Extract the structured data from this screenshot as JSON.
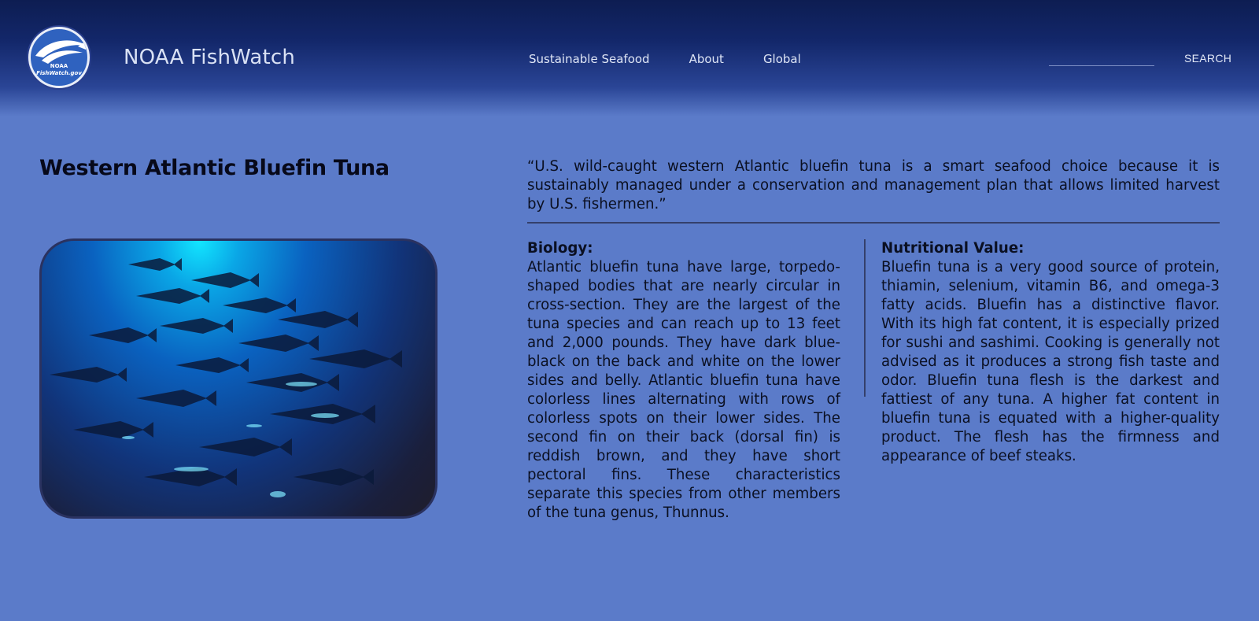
{
  "header": {
    "logo": {
      "icon": "noaa-fish-logo",
      "line1": "NOAA",
      "line2": "FishWatch.gov"
    },
    "site_title": "NOAA FishWatch",
    "nav": [
      {
        "label": "Sustainable Seafood"
      },
      {
        "label": "About"
      },
      {
        "label": "Global"
      }
    ],
    "search": {
      "placeholder": "",
      "button_label": "SEARCH"
    }
  },
  "main": {
    "title": "Western Atlantic Bluefin Tuna",
    "image": {
      "icon": "tuna-school-photo"
    },
    "quote": "“U.S. wild-caught western Atlantic bluefin tuna is a smart seafood choice because it is sustainably managed under a conservation and management plan that allows limited harvest by U.S. fishermen.”",
    "biology": {
      "heading": "Biology:",
      "text": "Atlantic bluefin tuna have large, torpedo-shaped bodies that are nearly circular in cross-section. They are the largest of the tuna species and can reach up to 13 feet and 2,000 pounds. They have dark blue-black on the back and white on the lower sides and belly. Atlantic bluefin tuna have colorless lines alternating with rows of colorless spots on their lower sides. The second fin on their back (dorsal fin) is reddish brown, and they have short pectoral fins. These characteristics separate this species from other members of the tuna genus, Thunnus."
    },
    "nutrition": {
      "heading": "Nutritional Value:",
      "text": "Bluefin tuna is a very good source of protein, thiamin, selenium, vitamin B6, and omega-3 fatty acids. Bluefin has a distinctive flavor. With its high fat content, it is especially prized for sushi and sashimi. Cooking is generally not advised as it produces a strong fish taste and odor. Bluefin tuna flesh is the darkest and fattiest of any tuna. A higher fat content in bluefin tuna is equated with a higher-quality product. The flesh has the firmness and appearance of beef steaks."
    }
  },
  "colors": {
    "background": "#5b7bc9",
    "header_dark": "#0d1d52",
    "text": "#0b1022"
  }
}
